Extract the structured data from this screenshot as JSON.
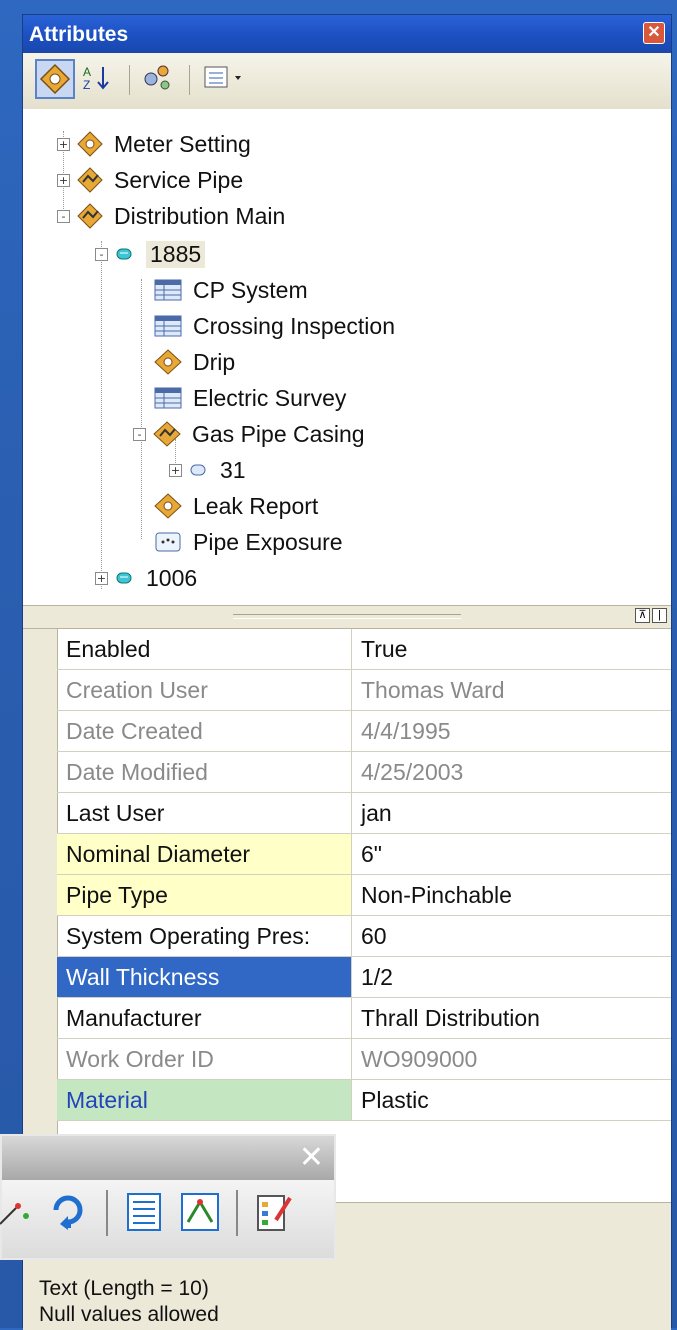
{
  "window": {
    "title": "Attributes"
  },
  "tree": {
    "layers": [
      {
        "label": "Meter Setting",
        "expander": "+"
      },
      {
        "label": "Service Pipe",
        "expander": "+"
      },
      {
        "label": "Distribution Main",
        "expander": "-"
      }
    ],
    "feature_1885": {
      "label": "1885",
      "expander": "-"
    },
    "related": [
      {
        "label": "CP System",
        "icon": "table-icon"
      },
      {
        "label": "Crossing Inspection",
        "icon": "table-icon"
      },
      {
        "label": "Drip",
        "icon": "point-feature-icon"
      },
      {
        "label": "Electric Survey",
        "icon": "table-icon"
      },
      {
        "label": "Gas Pipe Casing",
        "icon": "line-feature-icon",
        "expander": "-"
      },
      {
        "label": "31",
        "icon": "feature-icon",
        "expander": "+"
      },
      {
        "label": "Leak Report",
        "icon": "point-feature-icon"
      },
      {
        "label": "Pipe Exposure",
        "icon": "annotation-icon"
      }
    ],
    "feature_1006": {
      "label": "1006",
      "expander": "+"
    }
  },
  "attributes": [
    {
      "name": "Enabled",
      "value": "True",
      "style": "normal"
    },
    {
      "name": "Creation User",
      "value": "Thomas Ward",
      "style": "readonly"
    },
    {
      "name": "Date Created",
      "value": "4/4/1995",
      "style": "readonly"
    },
    {
      "name": "Date Modified",
      "value": "4/25/2003",
      "style": "readonly"
    },
    {
      "name": "Last User",
      "value": "jan",
      "style": "normal"
    },
    {
      "name": "Nominal Diameter",
      "value": "6\"",
      "style": "yellow"
    },
    {
      "name": "Pipe Type",
      "value": "Non-Pinchable",
      "style": "yellow"
    },
    {
      "name": "System Operating Pres:",
      "value": "60",
      "style": "normal"
    },
    {
      "name": "Wall Thickness",
      "value": "1/2",
      "style": "selected"
    },
    {
      "name": "Manufacturer",
      "value": "Thrall Distribution",
      "style": "normal"
    },
    {
      "name": "Work Order ID",
      "value": "WO909000",
      "style": "readonly"
    },
    {
      "name": "Material",
      "value": "Plastic",
      "style": "green"
    }
  ],
  "description": {
    "line1": "Text (Length = 10)",
    "line2": "Null values allowed"
  },
  "floating_toolbar": {
    "close": "✕"
  },
  "colors": {
    "yellow_row": "#ffffc8",
    "green_row": "#c4e6c0",
    "selected_row": "#3168c6",
    "readonly_text": "#8a8a8a",
    "green_text": "#2244bb"
  }
}
